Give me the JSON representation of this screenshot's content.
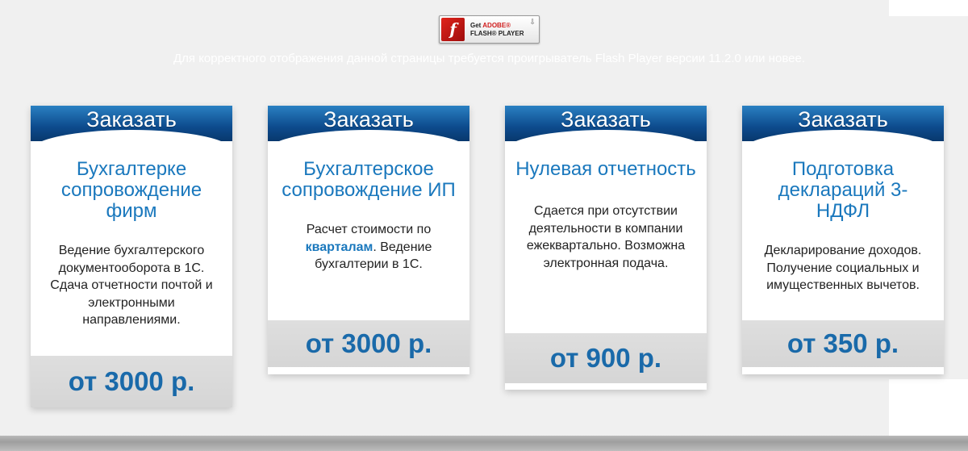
{
  "flash": {
    "badge_get": "Get",
    "badge_adobe": "ADOBE®",
    "badge_product": "FLASH® PLAYER",
    "notice": "Для корректного отображения данной страницы требуется проигрыватель Flash Player версии 11.2.0 или новее."
  },
  "cards": [
    {
      "button": "Заказать",
      "title": "Бухгалтерке сопровождение фирм",
      "desc": [
        "Ведение бухгалтерского документооборота в 1С. Сдача отчетности почтой и электронными направлениями."
      ],
      "price": "от 3000 р."
    },
    {
      "button": "Заказать",
      "title": "Бухгалтерское сопровождение ИП",
      "desc_before": "Расчет стоимости по ",
      "desc_highlight": "кварталам",
      "desc_after": ". Ведение бухгалтерии в 1С.",
      "price": "от 3000 р."
    },
    {
      "button": "Заказать",
      "title": "Нулевая отчетность",
      "desc": [
        "Сдается при отсутствии деятельности в компании ежеквартально. Возможна электронная подача."
      ],
      "price": "от 900 р."
    },
    {
      "button": "Заказать",
      "title": "Подготовка деклараций 3-НДФЛ",
      "desc": [
        "Декларирование доходов. Получение социальных и имущественных вычетов."
      ],
      "price": "от 350 р."
    }
  ],
  "colors": {
    "header_blue": "#0d4b8d",
    "title_blue": "#1a78bd",
    "price_blue": "#1a6cad",
    "price_bg": "#dedede",
    "page_bg": "#f0f0f0"
  }
}
